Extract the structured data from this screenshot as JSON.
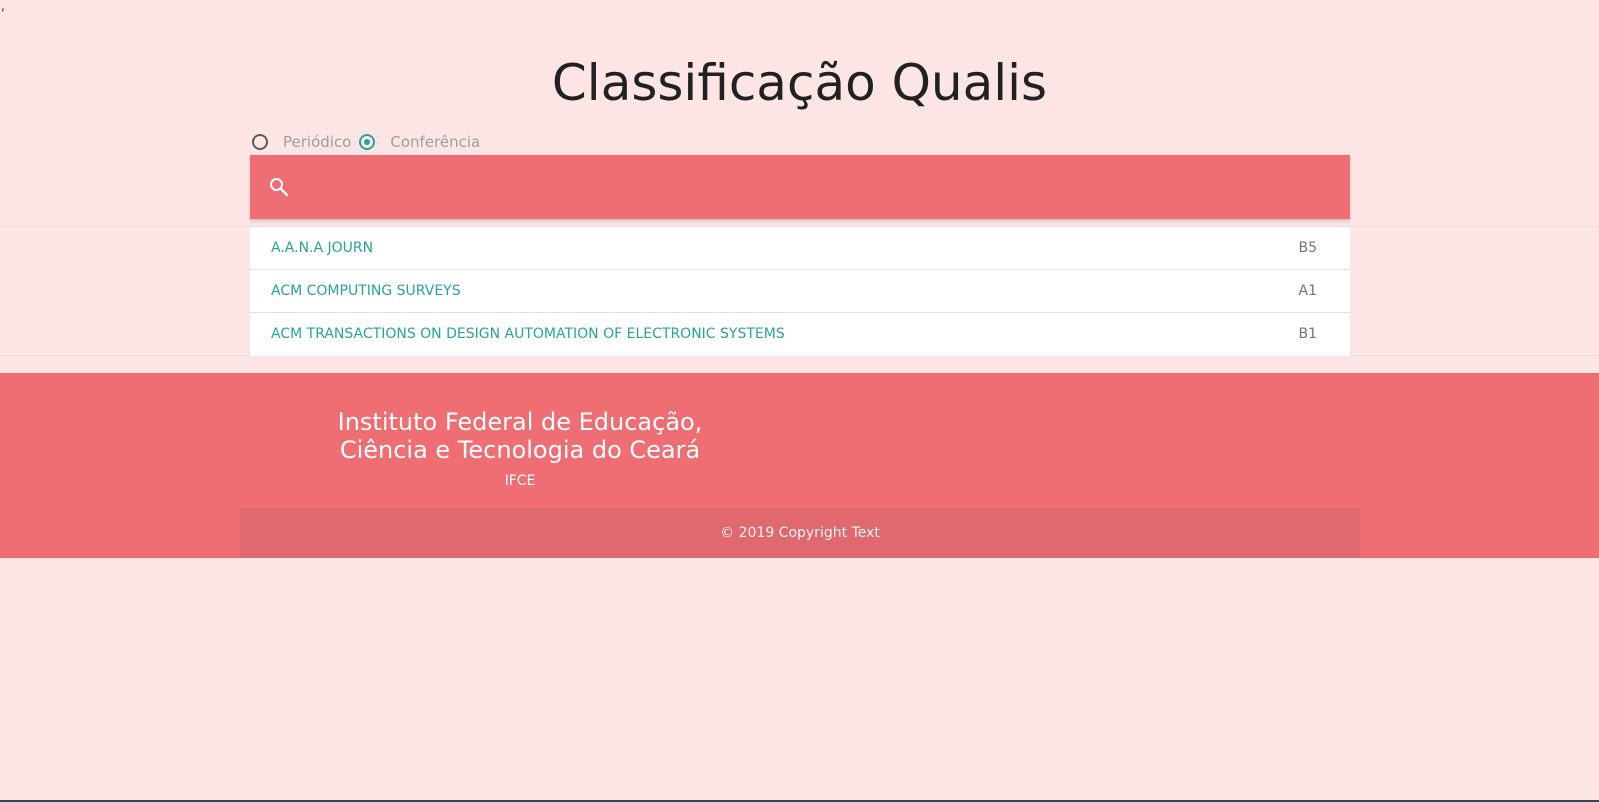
{
  "page": {
    "stray_mark": ",",
    "title": "Classificação Qualis"
  },
  "search_type": {
    "options": [
      {
        "label": "Periódico",
        "selected": false
      },
      {
        "label": "Conferência",
        "selected": true
      }
    ]
  },
  "search": {
    "icon": "search-icon",
    "value": "",
    "placeholder": ""
  },
  "results": [
    {
      "name": "A.A.N.A JOURN",
      "grade": "B5"
    },
    {
      "name": "ACM COMPUTING SURVEYS",
      "grade": "A1"
    },
    {
      "name": "ACM TRANSACTIONS ON DESIGN AUTOMATION OF ELECTRONIC SYSTEMS",
      "grade": "B1"
    }
  ],
  "footer": {
    "institution": "Instituto Federal de Educação, Ciência e Tecnologia do Ceará",
    "abbreviation": "IFCE",
    "copyright": "© 2019 Copyright Text"
  },
  "colors": {
    "background": "#fde5e6",
    "primary": "#ef6e73",
    "accent": "#26a69a",
    "copyright_bar": "#e0686e"
  }
}
